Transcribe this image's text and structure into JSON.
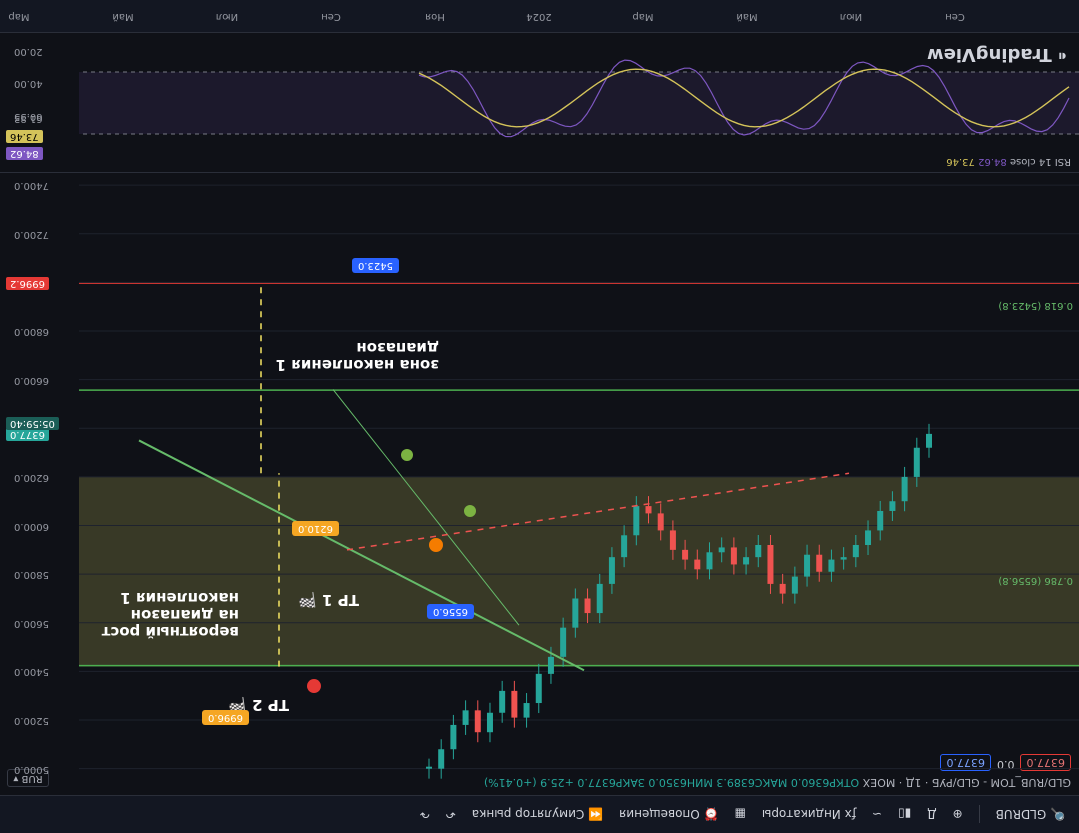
{
  "toolbar": {
    "symbol": "GLDRUB",
    "indicators": "Индикаторы",
    "alerts": "Оповещения",
    "replay": "Симулятор рынка"
  },
  "legend": {
    "title": "GLD/RUB_TOM - GLD/РУБ · 1Д · MOEX",
    "ohlc": "ОТКР6360.0 МАКС6389.3 МИН6350.0 ЗАКР6377.0 +25.9 (+0.41%)",
    "sell": "6377.0",
    "spread": "0.0",
    "buy": "6377.0",
    "currency": "RUB"
  },
  "logo": "TradingView",
  "rsi": {
    "title": "RSI 14 close",
    "v1": "84.62",
    "v2": "73.46",
    "ticks": [
      "20.00",
      "40.00",
      "60.35",
      "61.83",
      "73.46",
      "84.62"
    ]
  },
  "time_axis": [
    "Мар",
    "Май",
    "Июл",
    "Сен",
    "Ноя",
    "2024",
    "Мар",
    "Май",
    "Июл",
    "Сен"
  ],
  "annotations": {
    "tp2": "TP 2 🏁",
    "tp1": "TP 1 🏁",
    "growth": [
      "вероятный рост",
      "на диапазон",
      "накопления 1"
    ],
    "zone": [
      "зона накопления 1",
      "диапазон"
    ],
    "label_6996": "6996.0",
    "label_6210": "6210.0",
    "label_6556": "6556.0",
    "label_5423": "5423.0",
    "fib618": "0.618 (5423.8)",
    "fib786": "0.786 (6556.8)"
  },
  "chart_data": {
    "type": "line",
    "title": "GLD/RUB_TOM - GLD/РУБ · 1Д · MOEX",
    "x": [
      "Мар",
      "Май",
      "Июл",
      "Сен",
      "Ноя",
      "2024",
      "Мар",
      "Май",
      "Июл",
      "Сен"
    ],
    "price_ticks": [
      5000,
      5200,
      5400,
      5600,
      5800,
      6000,
      6200,
      6400,
      6600,
      6800,
      7000,
      7200,
      7400
    ],
    "ylim": [
      4900,
      7450
    ],
    "inverted": true,
    "axis_tags": {
      "last": "6377.0",
      "countdown": "05:59:40",
      "target": "6996.2"
    },
    "series": [
      {
        "values": [
          5000,
          5080,
          5180,
          5240,
          5150,
          5230,
          5320,
          5210,
          5270,
          5390,
          5460,
          5580,
          5700,
          5640,
          5760,
          5870,
          5960,
          6080,
          6050,
          5980,
          5900,
          5860,
          5820,
          5890,
          5910,
          5840,
          5870,
          5920,
          5760,
          5720,
          5790,
          5880,
          5810,
          5860,
          5870,
          5920,
          5980,
          6060,
          6100,
          6200,
          6320,
          6377
        ]
      }
    ],
    "levels": {
      "fib_0618": 5423.8,
      "fib_0786": 6556.8,
      "zone_top": 5420,
      "zone_bottom": 6200,
      "target": 6996.2
    }
  }
}
